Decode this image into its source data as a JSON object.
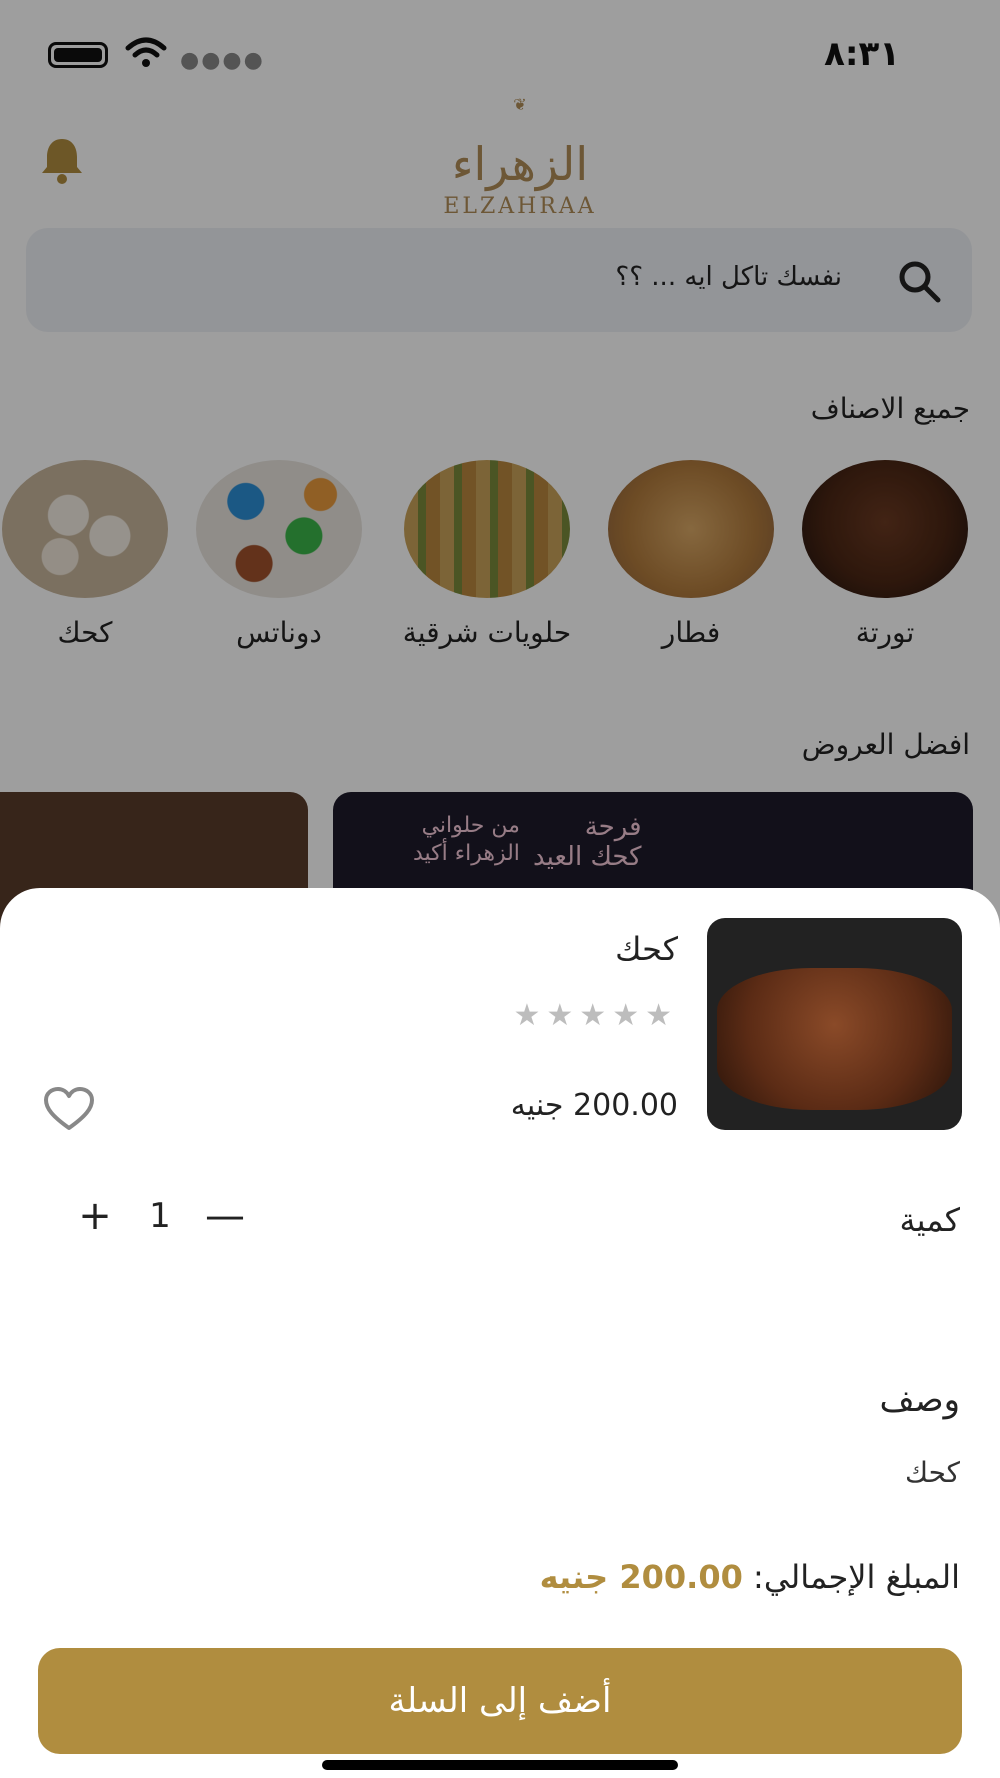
{
  "status_bar": {
    "time": "٨:٣١"
  },
  "header": {
    "logo_ar": "الزهراء",
    "logo_en": "ELZAHRAA"
  },
  "search": {
    "placeholder": "نفسك تاكل ايه ... ؟؟"
  },
  "categories": {
    "title": "جميع الاصناف",
    "items": [
      {
        "label": "تورتة"
      },
      {
        "label": "فطار"
      },
      {
        "label": "حلويات شرقية"
      },
      {
        "label": "دوناتس"
      },
      {
        "label": "كحك"
      }
    ]
  },
  "offers": {
    "title": "افضل العروض",
    "banner_text_1": "فرحة",
    "banner_text_2": "كحك العيد",
    "banner_text_3": "من حلواني",
    "banner_text_4": "الزهراء أكيد"
  },
  "product_sheet": {
    "name": "كحك",
    "rating": "★★★★★",
    "price": "200.00 جنيه",
    "quantity_label": "كمية",
    "quantity_value": "1",
    "plus": "+",
    "minus": "—",
    "description_title": "وصف",
    "description_text": "كحك",
    "total_label": "المبلغ الإجمالي:",
    "total_value": "200.00 جنيه",
    "add_to_cart": "أضف إلى السلة"
  },
  "colors": {
    "accent": "#b08d3f",
    "search_bg": "#eef0f6"
  }
}
